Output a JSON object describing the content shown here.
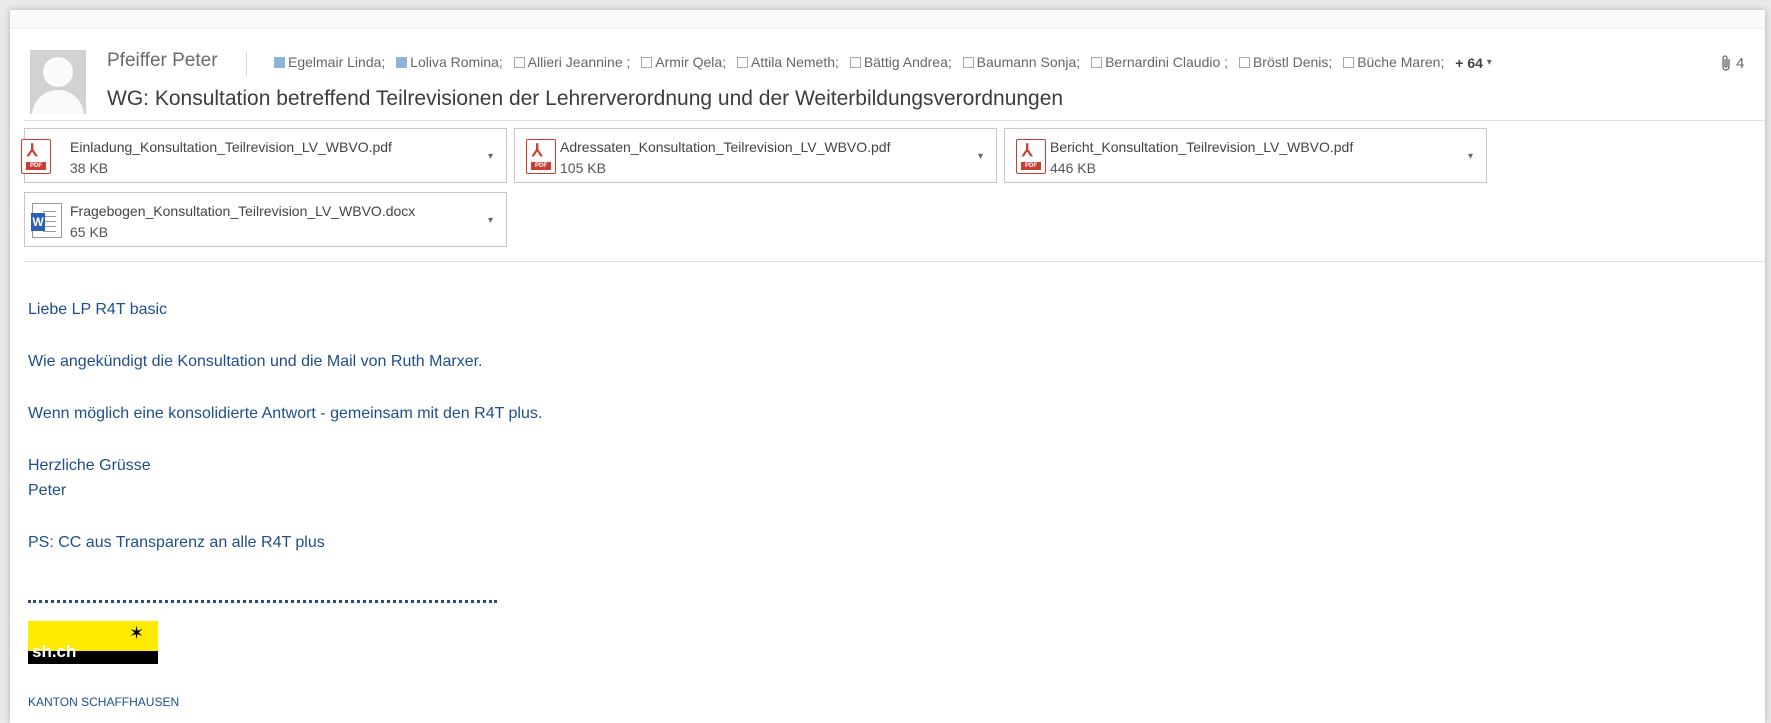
{
  "header": {
    "sender": "Pfeiffer Peter",
    "subject": "WG: Konsultation betreffend Teilrevisionen der Lehrerverordnung und der Weiterbildungsverordnungen",
    "recipients": [
      {
        "name": "Egelmair Linda;",
        "filled": true
      },
      {
        "name": "Loliva Romina;",
        "filled": true
      },
      {
        "name": "Allieri Jeannine ;",
        "filled": false
      },
      {
        "name": "Armir Qela;",
        "filled": false
      },
      {
        "name": "Attila Nemeth;",
        "filled": false
      },
      {
        "name": "Bättig Andrea;",
        "filled": false
      },
      {
        "name": "Baumann Sonja;",
        "filled": false
      },
      {
        "name": "Bernardini Claudio ;",
        "filled": false
      },
      {
        "name": "Bröstl Denis;",
        "filled": false
      },
      {
        "name": "Büche Maren;",
        "filled": false
      }
    ],
    "more_recipients": "+ 64",
    "attachment_count": "4",
    "icons": {
      "attachment": "paperclip-icon",
      "avatar": "person-silhouette-icon"
    }
  },
  "attachments": [
    {
      "name": "Einladung_Konsultation_Teilrevision_LV_WBVO.pdf",
      "size": "38 KB",
      "type": "pdf"
    },
    {
      "name": "Adressaten_Konsultation_Teilrevision_LV_WBVO.pdf",
      "size": "105 KB",
      "type": "pdf"
    },
    {
      "name": "Bericht_Konsultation_Teilrevision_LV_WBVO.pdf",
      "size": "446 KB",
      "type": "pdf"
    },
    {
      "name": "Fragebogen_Konsultation_Teilrevision_LV_WBVO.docx",
      "size": "65 KB",
      "type": "docx"
    }
  ],
  "body": {
    "greeting": "Liebe LP R4T basic",
    "line1": "Wie angekündigt die Konsultation und die Mail von Ruth Marxer.",
    "line2": "Wenn möglich eine konsolidierte Antwort - gemeinsam mit den R4T plus.",
    "closing": "Herzliche Grüsse",
    "signature": "Peter",
    "ps": "PS: CC aus Transparenz an alle R4T plus"
  },
  "footer": {
    "logo_text": "sh.ch",
    "org": "KANTON SCHAFFHAUSEN"
  },
  "colors": {
    "body_text": "#1f4e8c",
    "pdf_red": "#cc3d33",
    "word_blue": "#2b5fb5",
    "logo_yellow": "#ffeb00"
  }
}
